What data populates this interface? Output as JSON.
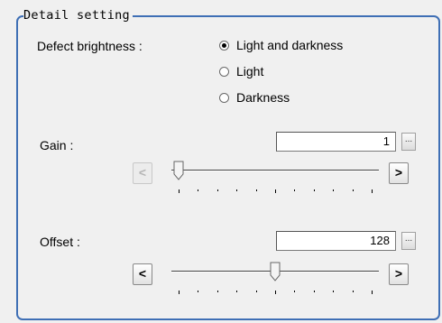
{
  "group_title": "Detail setting",
  "defect_brightness": {
    "label": "Defect brightness :",
    "options": [
      "Light and darkness",
      "Light",
      "Darkness"
    ],
    "selected": "Light and darkness"
  },
  "gain": {
    "label": "Gain :",
    "value": "1",
    "ellipsis": "...",
    "dec_label": "<",
    "inc_label": ">",
    "dec_enabled": false,
    "level": 0
  },
  "offset": {
    "label": "Offset :",
    "value": "128",
    "ellipsis": "...",
    "dec_label": "<",
    "inc_label": ">",
    "dec_enabled": true,
    "level": 0.5
  },
  "colors": {
    "frame": "#3f6fb5",
    "background": "#f0f0f0"
  }
}
